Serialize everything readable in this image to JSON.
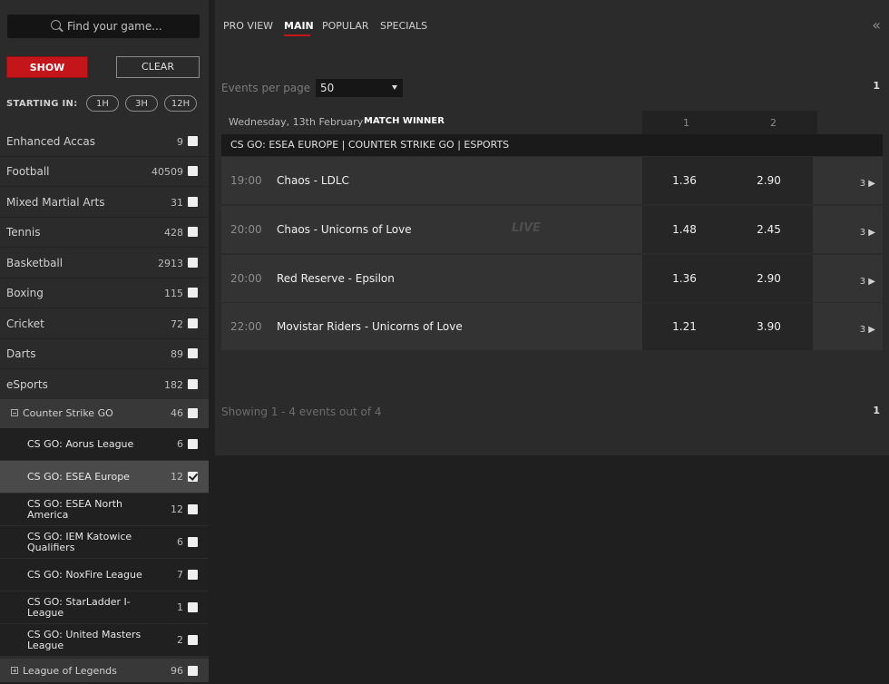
{
  "search": {
    "placeholder": "Find your game..."
  },
  "filters": {
    "show_label": "SHOW",
    "clear_label": "CLEAR",
    "starting_in_label": "STARTING IN:",
    "time_options": [
      "1H",
      "3H",
      "12H"
    ]
  },
  "sports": [
    {
      "name": "Enhanced Accas",
      "count": "9"
    },
    {
      "name": "Football",
      "count": "40509"
    },
    {
      "name": "Mixed Martial Arts",
      "count": "31"
    },
    {
      "name": "Tennis",
      "count": "428"
    },
    {
      "name": "Basketball",
      "count": "2913"
    },
    {
      "name": "Boxing",
      "count": "115"
    },
    {
      "name": "Cricket",
      "count": "72"
    },
    {
      "name": "Darts",
      "count": "89"
    },
    {
      "name": "eSports",
      "count": "182"
    }
  ],
  "subcategory": {
    "name": "Counter Strike GO",
    "count": "46"
  },
  "competitions": [
    {
      "name": "CS GO: Aorus League",
      "count": "6",
      "checked": false
    },
    {
      "name": "CS GO: ESEA Europe",
      "count": "12",
      "checked": true
    },
    {
      "name": "CS GO: ESEA North America",
      "count": "12",
      "checked": false
    },
    {
      "name": "CS GO: IEM Katowice Qualifiers",
      "count": "6",
      "checked": false
    },
    {
      "name": "CS GO: NoxFire League",
      "count": "7",
      "checked": false
    },
    {
      "name": "CS GO: StarLadder I-League",
      "count": "1",
      "checked": false
    },
    {
      "name": "CS GO: United Masters League",
      "count": "2",
      "checked": false
    }
  ],
  "next_subcategory": {
    "name": "League of Legends",
    "count": "96"
  },
  "tabs": [
    "PRO VIEW",
    "MAIN",
    "POPULAR",
    "SPECIALS"
  ],
  "active_tab": "MAIN",
  "events_per_page": {
    "label": "Events per page",
    "value": "50"
  },
  "page_number": "1",
  "date_label": "Wednesday, 13th February",
  "market_label": "MATCH WINNER",
  "columns": [
    "1",
    "2"
  ],
  "group_title": "CS GO: ESEA EUROPE | COUNTER STRIKE GO | ESPORTS",
  "live_badge": "LIVE",
  "events": [
    {
      "time": "19:00",
      "match": "Chaos - LDLC",
      "odd1": "1.36",
      "odd2": "2.90",
      "more": "3",
      "live": false
    },
    {
      "time": "20:00",
      "match": "Chaos - Unicorns of Love",
      "odd1": "1.48",
      "odd2": "2.45",
      "more": "3",
      "live": true
    },
    {
      "time": "20:00",
      "match": "Red Reserve - Epsilon",
      "odd1": "1.36",
      "odd2": "2.90",
      "more": "3",
      "live": false
    },
    {
      "time": "22:00",
      "match": "Movistar Riders - Unicorns of Love",
      "odd1": "1.21",
      "odd2": "3.90",
      "more": "3",
      "live": false
    }
  ],
  "showing_text": "Showing 1 - 4 events out of 4"
}
